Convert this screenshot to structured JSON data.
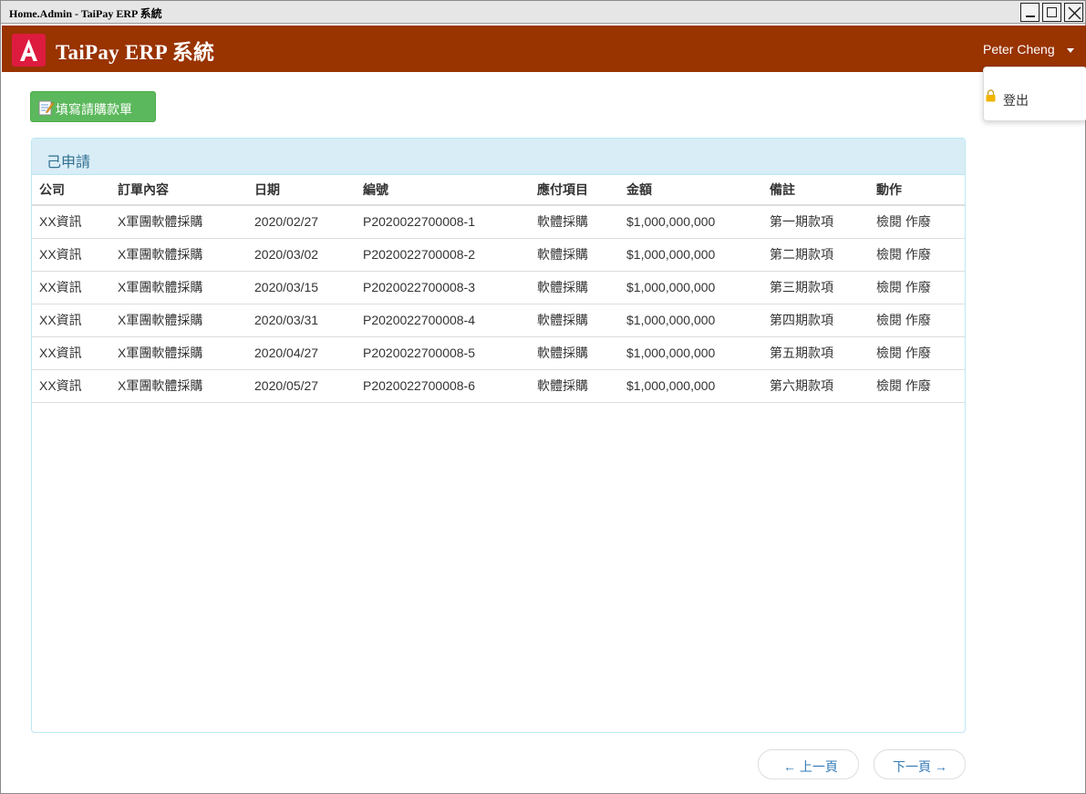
{
  "window": {
    "title": "Home.Admin - TaiPay ERP 系統"
  },
  "navbar": {
    "brand": "TaiPay ERP 系統",
    "user_name": "Peter Cheng",
    "background": "#993300",
    "logo_color": "#dd1b3f"
  },
  "user_menu": {
    "items": [
      {
        "label": "登出",
        "icon": "lock-icon"
      }
    ]
  },
  "toolbar": {
    "new_request_label": "填寫請購款單",
    "new_request_icon": "memo-icon"
  },
  "panel": {
    "title": "己申請",
    "columns": [
      "公司",
      "訂單內容",
      "日期",
      "編號",
      "應付項目",
      "金額",
      "備註",
      "動作"
    ],
    "rows": [
      {
        "company": "XX資訊",
        "content": "X軍團軟體採購",
        "date": "2020/02/27",
        "number": "P2020022700008-1",
        "item": "軟體採購",
        "amount": "$1,000,000,000",
        "note": "第一期款項",
        "view": "檢閱",
        "void": "作廢"
      },
      {
        "company": "XX資訊",
        "content": "X軍團軟體採購",
        "date": "2020/03/02",
        "number": "P2020022700008-2",
        "item": "軟體採購",
        "amount": "$1,000,000,000",
        "note": "第二期款項",
        "view": "檢閱",
        "void": "作廢"
      },
      {
        "company": "XX資訊",
        "content": "X軍團軟體採購",
        "date": "2020/03/15",
        "number": "P2020022700008-3",
        "item": "軟體採購",
        "amount": "$1,000,000,000",
        "note": "第三期款項",
        "view": "檢閱",
        "void": "作廢"
      },
      {
        "company": "XX資訊",
        "content": "X軍團軟體採購",
        "date": "2020/03/31",
        "number": "P2020022700008-4",
        "item": "軟體採購",
        "amount": "$1,000,000,000",
        "note": "第四期款項",
        "view": "檢閱",
        "void": "作廢"
      },
      {
        "company": "XX資訊",
        "content": "X軍團軟體採購",
        "date": "2020/04/27",
        "number": "P2020022700008-5",
        "item": "軟體採購",
        "amount": "$1,000,000,000",
        "note": "第五期款項",
        "view": "檢閱",
        "void": "作廢"
      },
      {
        "company": "XX資訊",
        "content": "X軍團軟體採購",
        "date": "2020/05/27",
        "number": "P2020022700008-6",
        "item": "軟體採購",
        "amount": "$1,000,000,000",
        "note": "第六期款項",
        "view": "檢閱",
        "void": "作廢"
      }
    ]
  },
  "pager": {
    "prev_label": "← 上一頁",
    "next_label": "下一頁 →"
  }
}
